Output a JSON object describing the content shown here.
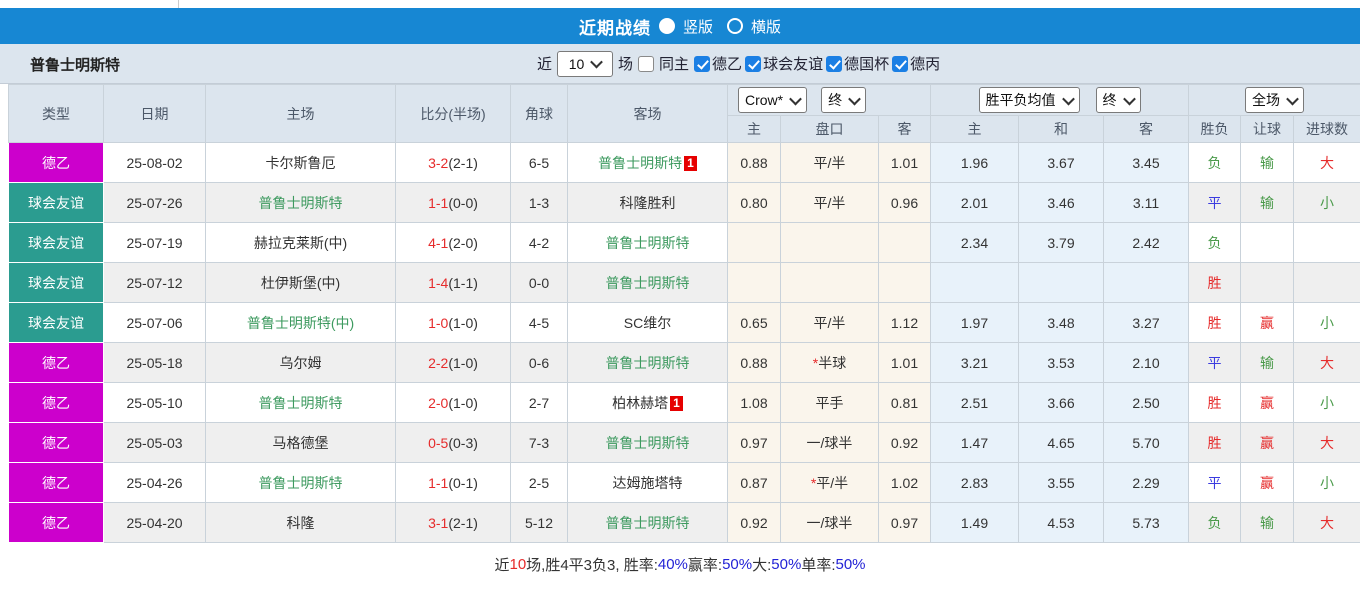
{
  "titlebar": {
    "title": "近期战绩",
    "radio_vertical": "竖版",
    "radio_horizontal": "横版"
  },
  "filter_bar": {
    "team_name": "普鲁士明斯特",
    "near_label": "近",
    "matches_count": "10",
    "games_label": "场",
    "same_home_label": "同主",
    "same_home_checked": false,
    "leagues": [
      "德乙",
      "球会友谊",
      "德国杯",
      "德丙"
    ]
  },
  "table": {
    "selects": {
      "provider": "Crow*",
      "final1": "终",
      "avg": "胜平负均值",
      "final2": "终",
      "scope": "全场"
    },
    "col_headers": {
      "type": "类型",
      "date": "日期",
      "home": "主场",
      "score": "比分(半场)",
      "corners": "角球",
      "away": "客场",
      "odds_home": "主",
      "handicap": "盘口",
      "odds_away": "客",
      "avg_home": "主",
      "avg_draw": "和",
      "avg_away": "客",
      "result": "胜负",
      "handicap_result": "让球",
      "goals": "进球数"
    },
    "rows": [
      {
        "type": "德乙",
        "color": "#cc00cc",
        "date": "25-08-02",
        "home": "卡尔斯鲁厄",
        "home_green": false,
        "home_badge": "",
        "score": "3-2",
        "half": "(2-1)",
        "corners": "6-5",
        "away": "普鲁士明斯特",
        "away_green": true,
        "away_badge": "1",
        "odds": [
          "0.88",
          "平/半",
          "1.01"
        ],
        "star": false,
        "avg": [
          "1.96",
          "3.67",
          "3.45"
        ],
        "result": "负",
        "result_color": "green",
        "let": "输",
        "let_color": "green",
        "goal": "大",
        "goal_color": "red"
      },
      {
        "type": "球会友谊",
        "color": "#2b9c90",
        "date": "25-07-26",
        "home": "普鲁士明斯特",
        "home_green": true,
        "home_badge": "",
        "score": "1-1",
        "half": "(0-0)",
        "corners": "1-3",
        "away": "科隆胜利",
        "away_green": false,
        "away_badge": "",
        "odds": [
          "0.80",
          "平/半",
          "0.96"
        ],
        "star": false,
        "avg": [
          "2.01",
          "3.46",
          "3.11"
        ],
        "result": "平",
        "result_color": "blue",
        "let": "输",
        "let_color": "green",
        "goal": "小",
        "goal_color": "green"
      },
      {
        "type": "球会友谊",
        "color": "#2b9c90",
        "date": "25-07-19",
        "home": "赫拉克莱斯(中)",
        "home_green": false,
        "home_badge": "",
        "score": "4-1",
        "half": "(2-0)",
        "corners": "4-2",
        "away": "普鲁士明斯特",
        "away_green": true,
        "away_badge": "",
        "odds": [
          "",
          "",
          ""
        ],
        "star": false,
        "avg": [
          "2.34",
          "3.79",
          "2.42"
        ],
        "result": "负",
        "result_color": "green",
        "let": "",
        "let_color": "",
        "goal": "",
        "goal_color": ""
      },
      {
        "type": "球会友谊",
        "color": "#2b9c90",
        "date": "25-07-12",
        "home": "杜伊斯堡(中)",
        "home_green": false,
        "home_badge": "",
        "score": "1-4",
        "half": "(1-1)",
        "corners": "0-0",
        "away": "普鲁士明斯特",
        "away_green": true,
        "away_badge": "",
        "odds": [
          "",
          "",
          ""
        ],
        "star": false,
        "avg": [
          "",
          "",
          ""
        ],
        "result": "胜",
        "result_color": "red",
        "let": "",
        "let_color": "",
        "goal": "",
        "goal_color": ""
      },
      {
        "type": "球会友谊",
        "color": "#2b9c90",
        "date": "25-07-06",
        "home": "普鲁士明斯特(中)",
        "home_green": true,
        "home_badge": "",
        "score": "1-0",
        "half": "(1-0)",
        "corners": "4-5",
        "away": "SC维尔",
        "away_green": false,
        "away_badge": "",
        "odds": [
          "0.65",
          "平/半",
          "1.12"
        ],
        "star": false,
        "avg": [
          "1.97",
          "3.48",
          "3.27"
        ],
        "result": "胜",
        "result_color": "red",
        "let": "赢",
        "let_color": "red",
        "goal": "小",
        "goal_color": "green"
      },
      {
        "type": "德乙",
        "color": "#cc00cc",
        "date": "25-05-18",
        "home": "乌尔姆",
        "home_green": false,
        "home_badge": "",
        "score": "2-2",
        "half": "(1-0)",
        "corners": "0-6",
        "away": "普鲁士明斯特",
        "away_green": true,
        "away_badge": "",
        "odds": [
          "0.88",
          "半球",
          "1.01"
        ],
        "star": true,
        "avg": [
          "3.21",
          "3.53",
          "2.10"
        ],
        "result": "平",
        "result_color": "blue",
        "let": "输",
        "let_color": "green",
        "goal": "大",
        "goal_color": "red"
      },
      {
        "type": "德乙",
        "color": "#cc00cc",
        "date": "25-05-10",
        "home": "普鲁士明斯特",
        "home_green": true,
        "home_badge": "",
        "score": "2-0",
        "half": "(1-0)",
        "corners": "2-7",
        "away": "柏林赫塔",
        "away_green": false,
        "away_badge": "1",
        "odds": [
          "1.08",
          "平手",
          "0.81"
        ],
        "star": false,
        "avg": [
          "2.51",
          "3.66",
          "2.50"
        ],
        "result": "胜",
        "result_color": "red",
        "let": "赢",
        "let_color": "red",
        "goal": "小",
        "goal_color": "green"
      },
      {
        "type": "德乙",
        "color": "#cc00cc",
        "date": "25-05-03",
        "home": "马格德堡",
        "home_green": false,
        "home_badge": "",
        "score": "0-5",
        "half": "(0-3)",
        "corners": "7-3",
        "away": "普鲁士明斯特",
        "away_green": true,
        "away_badge": "",
        "odds": [
          "0.97",
          "一/球半",
          "0.92"
        ],
        "star": false,
        "avg": [
          "1.47",
          "4.65",
          "5.70"
        ],
        "result": "胜",
        "result_color": "red",
        "let": "赢",
        "let_color": "red",
        "goal": "大",
        "goal_color": "red"
      },
      {
        "type": "德乙",
        "color": "#cc00cc",
        "date": "25-04-26",
        "home": "普鲁士明斯特",
        "home_green": true,
        "home_badge": "",
        "score": "1-1",
        "half": "(0-1)",
        "corners": "2-5",
        "away": "达姆施塔特",
        "away_green": false,
        "away_badge": "",
        "odds": [
          "0.87",
          "平/半",
          "1.02"
        ],
        "star": true,
        "avg": [
          "2.83",
          "3.55",
          "2.29"
        ],
        "result": "平",
        "result_color": "blue",
        "let": "赢",
        "let_color": "red",
        "goal": "小",
        "goal_color": "green"
      },
      {
        "type": "德乙",
        "color": "#cc00cc",
        "date": "25-04-20",
        "home": "科隆",
        "home_green": false,
        "home_badge": "",
        "score": "3-1",
        "half": "(2-1)",
        "corners": "5-12",
        "away": "普鲁士明斯特",
        "away_green": true,
        "away_badge": "",
        "odds": [
          "0.92",
          "一/球半",
          "0.97"
        ],
        "star": false,
        "avg": [
          "1.49",
          "4.53",
          "5.73"
        ],
        "result": "负",
        "result_color": "green",
        "let": "输",
        "let_color": "green",
        "goal": "大",
        "goal_color": "red"
      }
    ]
  },
  "summary": {
    "segments": [
      {
        "text": "近",
        "color": "dark"
      },
      {
        "text": "10",
        "color": "red"
      },
      {
        "text": "场,胜4平3负3, 胜率:",
        "color": "dark"
      },
      {
        "text": "40%",
        "color": "blue"
      },
      {
        "text": " 赢率:",
        "color": "dark"
      },
      {
        "text": "50%",
        "color": "blue"
      },
      {
        "text": " 大:",
        "color": "dark"
      },
      {
        "text": "50%",
        "color": "blue"
      },
      {
        "text": " 单率:",
        "color": "dark"
      },
      {
        "text": "50%",
        "color": "blue"
      }
    ]
  },
  "colors": {
    "accent_blue": "#1787d3",
    "league_de2": "#cc00cc",
    "league_friendly": "#2b9c90",
    "win_red": "#e62b2b",
    "draw_blue": "#3c3ce0",
    "lose_green": "#4a9a4a",
    "team_green": "#3d9a5f",
    "odds_col_bg": "#faf5ec",
    "avg_col_bg": "#e8f2fa"
  }
}
